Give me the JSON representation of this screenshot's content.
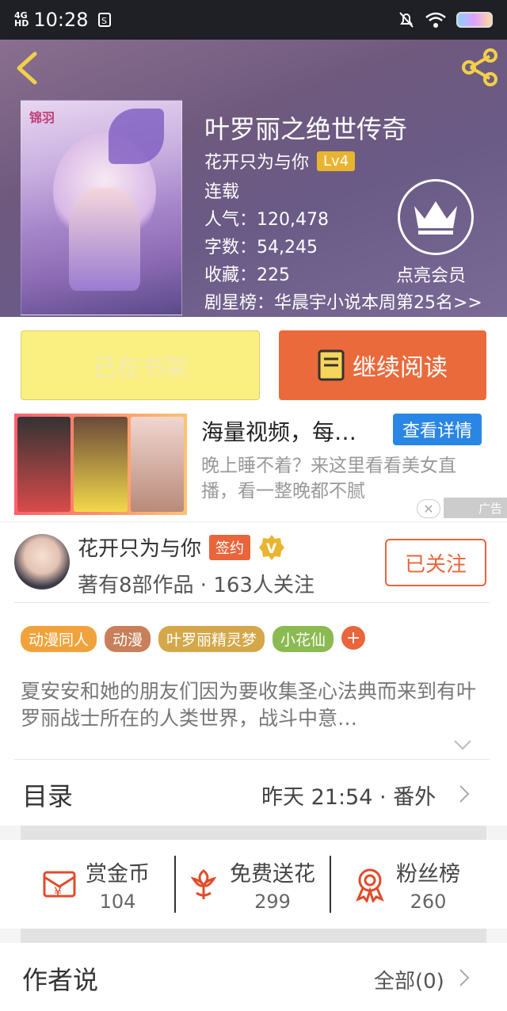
{
  "status_bar": {
    "network": "4G",
    "network_sub": "HD",
    "time": "10:28"
  },
  "book": {
    "title": "叶罗丽之绝世传奇",
    "cover_brand": "锦羽",
    "author": "花开只为与你",
    "author_level": "Lv4",
    "status": "连载",
    "popularity": "人气：120,478",
    "word_count": "字数：54,245",
    "favorites": "收藏：225",
    "ranking": "剧星榜：华晨宇小说本周第25名>>",
    "vip_label": "点亮会员"
  },
  "buttons": {
    "on_shelf": "已在书架",
    "continue_reading": "继续阅读"
  },
  "ad": {
    "title": "海量视频，每…",
    "detail_button": "查看详情",
    "description": "晚上睡不着？来这里看看美女直播，看一整晚都不腻",
    "tag": "广告"
  },
  "author_card": {
    "name": "花开只为与你",
    "sign_badge": "签约",
    "stats": "著有8部作品 · 163人关注",
    "follow_button": "已关注"
  },
  "tags": [
    {
      "label": "动漫同人",
      "color": "#f0a33c"
    },
    {
      "label": "动漫",
      "color": "#c87f5a"
    },
    {
      "label": "叶罗丽精灵梦",
      "color": "#d4a84a"
    },
    {
      "label": "小花仙",
      "color": "#8cba52"
    }
  ],
  "synopsis": "夏安安和她的朋友们因为要收集圣心法典而来到有叶罗丽战士所在的人类世界，战斗中意…",
  "toc": {
    "label": "目录",
    "latest_update": "昨天 21:54 · 番外"
  },
  "actions": [
    {
      "name": "赏金币",
      "count": "104",
      "icon": "reward-coin-icon"
    },
    {
      "name": "免费送花",
      "count": "299",
      "icon": "flower-icon"
    },
    {
      "name": "粉丝榜",
      "count": "260",
      "icon": "fan-rank-icon"
    }
  ],
  "author_says": {
    "label": "作者说",
    "all": "全部(0)"
  },
  "colors": {
    "accent": "#e9653c",
    "shelf_button": "#faf082",
    "ad_button": "#2a86e4",
    "level_badge": "#e9b530"
  }
}
